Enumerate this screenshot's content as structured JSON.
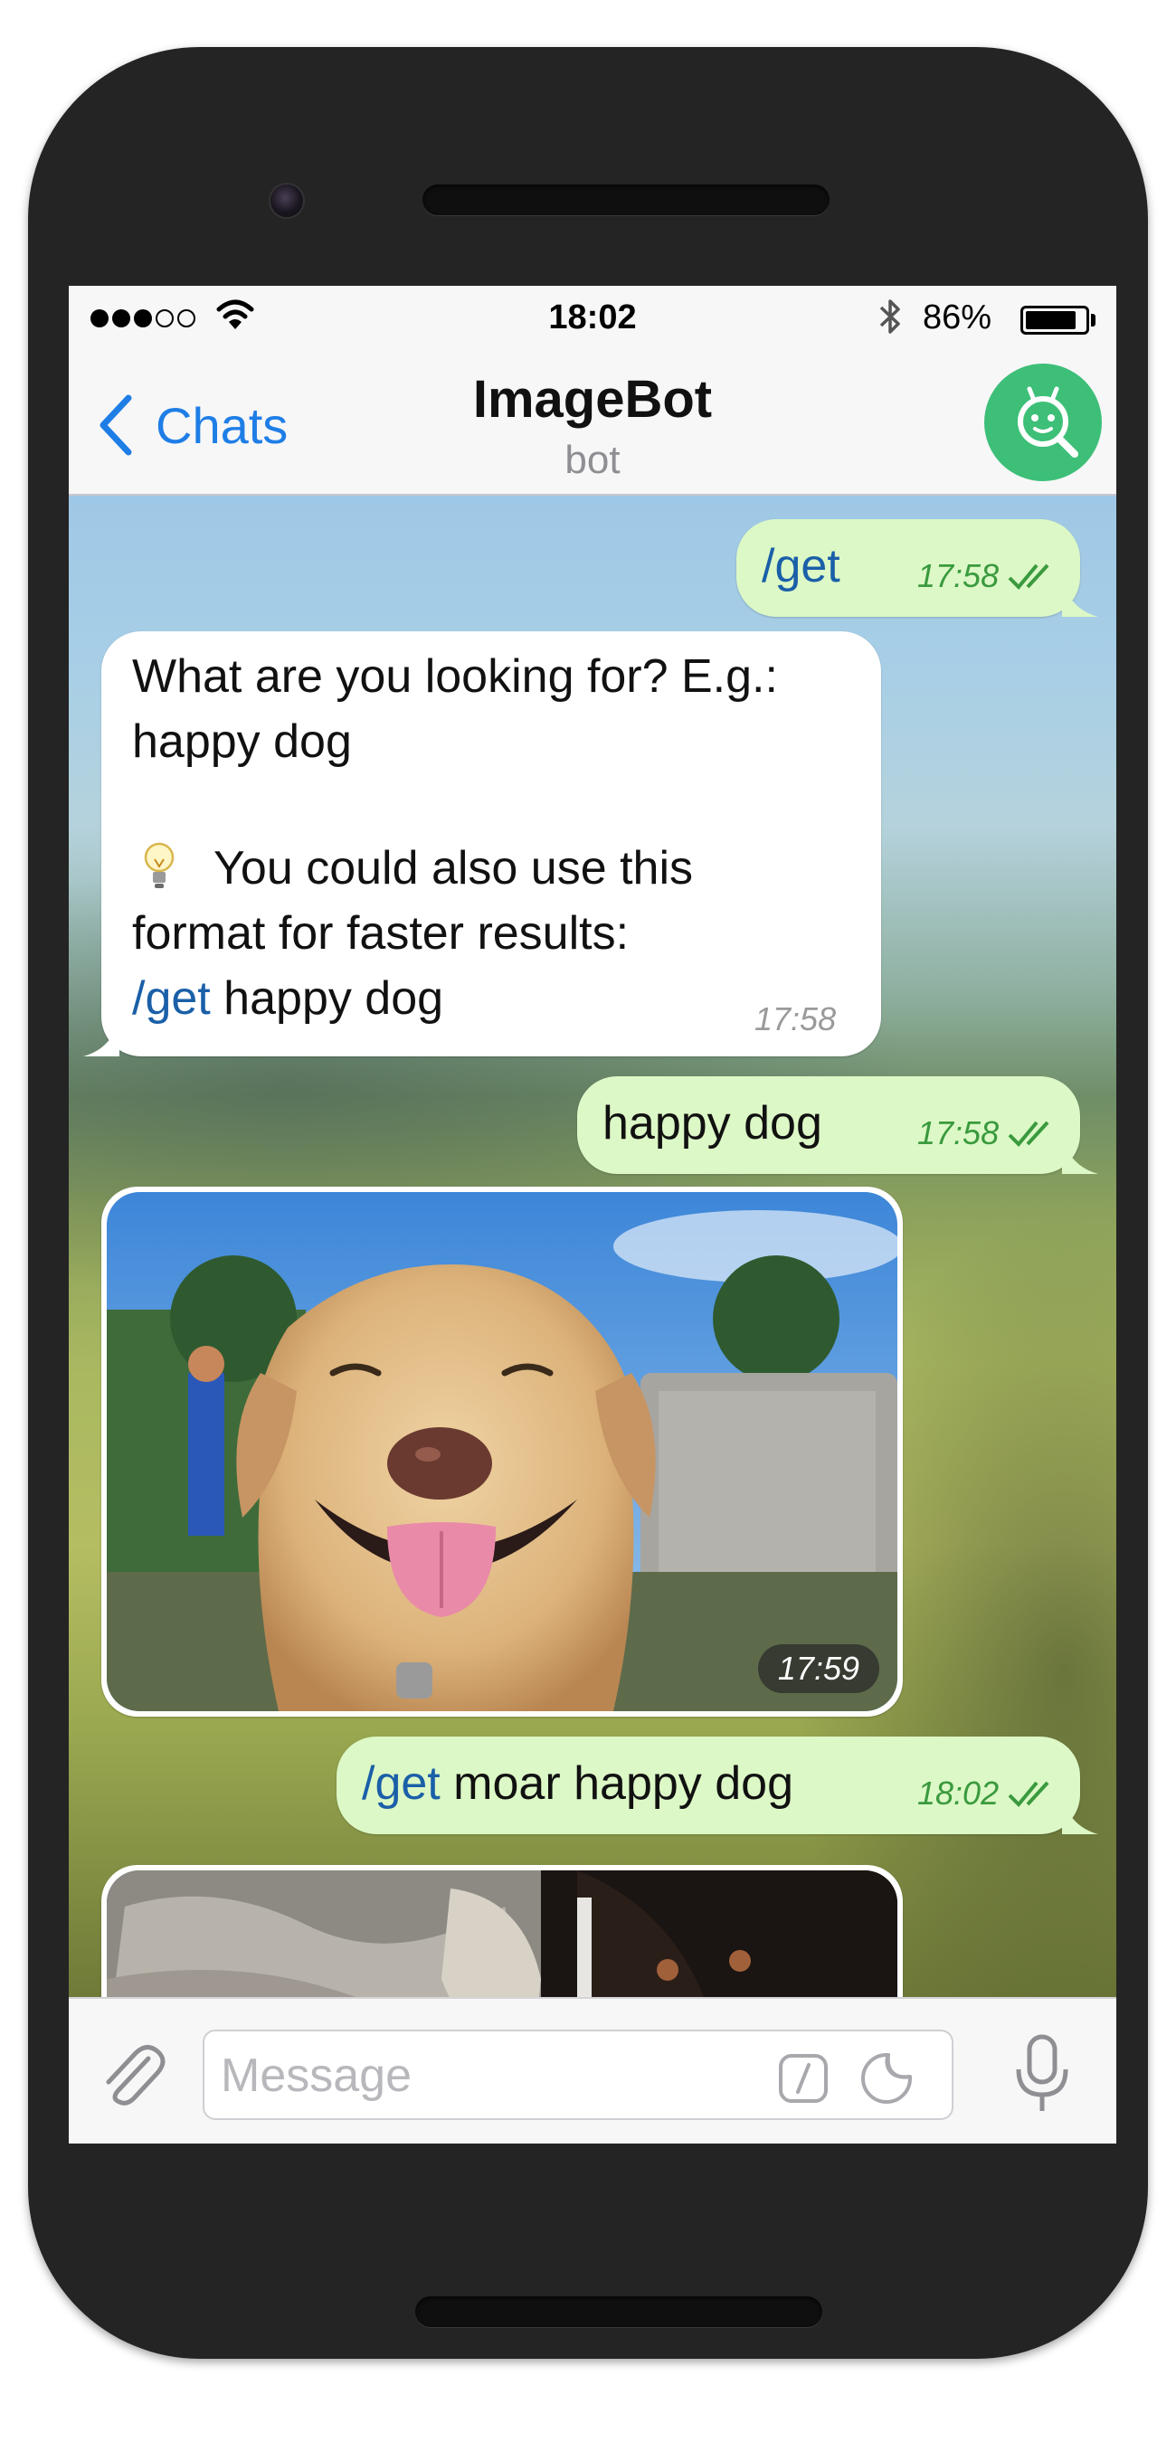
{
  "status_bar": {
    "time": "18:02",
    "battery_percent": "86%",
    "battery_level": 0.86,
    "signal_bars_filled": 3,
    "signal_bars_total": 5
  },
  "nav": {
    "back_label": "Chats",
    "title": "ImageBot",
    "subtitle": "bot"
  },
  "messages": {
    "m1": {
      "command": "/get",
      "time": "17:58"
    },
    "m2": {
      "line1": "What are you looking for? E.g.:",
      "line2": "happy dog",
      "line3": "You could also use this",
      "line4": "format for faster results:",
      "line5_command": "/get",
      "line5_text": " happy dog",
      "time": "17:58"
    },
    "m3": {
      "text": "happy dog",
      "time": "17:58"
    },
    "m4": {
      "time": "17:59"
    },
    "m5": {
      "command": "/get",
      "text": " moar happy dog",
      "time": "18:02"
    }
  },
  "input": {
    "placeholder": "Message"
  },
  "colors": {
    "accent": "#1f7ee6",
    "outgoing_bubble": "#dcf8c6",
    "bot_avatar": "#3dbf78",
    "command": "#1a5fa8"
  },
  "icons": {
    "back": "chevron-left-icon",
    "bot": "bot-search-icon",
    "attach": "paperclip-icon",
    "slash": "slash-command-icon",
    "sticker": "sticker-icon",
    "mic": "microphone-icon",
    "read": "double-check-icon"
  }
}
